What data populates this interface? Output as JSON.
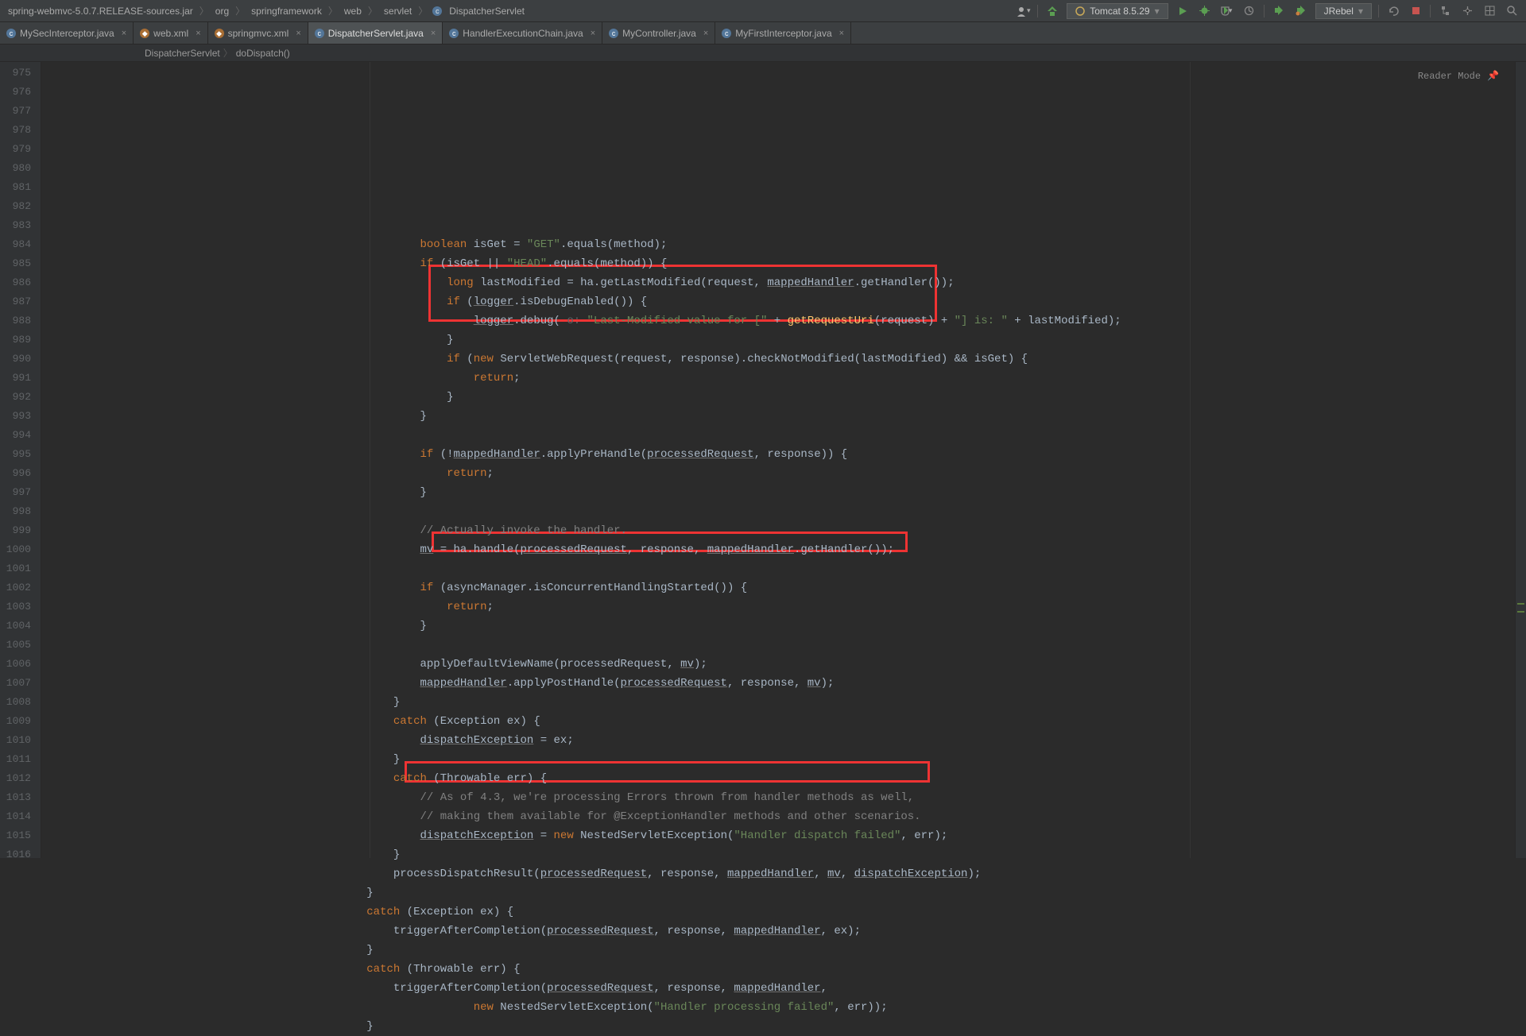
{
  "breadcrumb": {
    "items": [
      "spring-webmvc-5.0.7.RELEASE-sources.jar",
      "org",
      "springframework",
      "web",
      "servlet",
      "DispatcherServlet"
    ]
  },
  "runconfig": {
    "label": "Tomcat 8.5.29"
  },
  "jrebel": {
    "label": "JRebel"
  },
  "tabs": [
    {
      "label": "MySecInterceptor.java",
      "icon": "java",
      "active": false
    },
    {
      "label": "web.xml",
      "icon": "xml",
      "active": false
    },
    {
      "label": "springmvc.xml",
      "icon": "xml",
      "active": false
    },
    {
      "label": "DispatcherServlet.java",
      "icon": "java",
      "active": true
    },
    {
      "label": "HandlerExecutionChain.java",
      "icon": "java",
      "active": false
    },
    {
      "label": "MyController.java",
      "icon": "java",
      "active": false
    },
    {
      "label": "MyFirstInterceptor.java",
      "icon": "java",
      "active": false
    }
  ],
  "navpath": {
    "items": [
      "DispatcherServlet",
      "doDispatch()"
    ]
  },
  "reader_mode": "Reader Mode",
  "lines": {
    "start": 975,
    "end": 1016
  },
  "code": {
    "l975": {
      "indent": 20,
      "tokens": [
        {
          "t": "k",
          "v": "boolean"
        },
        {
          "t": "m",
          "v": " isGet = "
        },
        {
          "t": "s",
          "v": "\"GET\""
        },
        {
          "t": "m",
          "v": ".equals(method);"
        }
      ]
    },
    "l976": {
      "indent": 20,
      "tokens": [
        {
          "t": "k",
          "v": "if"
        },
        {
          "t": "m",
          "v": " (isGet || "
        },
        {
          "t": "s",
          "v": "\"HEAD\""
        },
        {
          "t": "m",
          "v": ".equals(method)) {"
        }
      ]
    },
    "l977": {
      "indent": 24,
      "tokens": [
        {
          "t": "k",
          "v": "long"
        },
        {
          "t": "m",
          "v": " lastModified = ha.getLastModified(request, "
        },
        {
          "t": "vu",
          "v": "mappedHandler"
        },
        {
          "t": "m",
          "v": ".getHandler());"
        }
      ]
    },
    "l978": {
      "indent": 24,
      "tokens": [
        {
          "t": "k",
          "v": "if"
        },
        {
          "t": "m",
          "v": " ("
        },
        {
          "t": "vu",
          "v": "logger"
        },
        {
          "t": "m",
          "v": ".isDebugEnabled()) {"
        }
      ]
    },
    "l979": {
      "indent": 28,
      "tokens": [
        {
          "t": "vu",
          "v": "logger"
        },
        {
          "t": "m",
          "v": ".debug("
        },
        {
          "t": "hint",
          "v": " o: "
        },
        {
          "t": "s",
          "v": "\"Last-Modified value for [\""
        },
        {
          "t": "m",
          "v": " + "
        },
        {
          "t": "fn",
          "v": "getRequestUri"
        },
        {
          "t": "m",
          "v": "(request) + "
        },
        {
          "t": "s",
          "v": "\"] is: \""
        },
        {
          "t": "m",
          "v": " + lastModified);"
        }
      ]
    },
    "l980": {
      "indent": 24,
      "tokens": [
        {
          "t": "m",
          "v": "}"
        }
      ]
    },
    "l981": {
      "indent": 24,
      "tokens": [
        {
          "t": "k",
          "v": "if"
        },
        {
          "t": "m",
          "v": " ("
        },
        {
          "t": "k",
          "v": "new"
        },
        {
          "t": "m",
          "v": " ServletWebRequest(request, response).checkNotModified(lastModified) && isGet) {"
        }
      ]
    },
    "l982": {
      "indent": 28,
      "tokens": [
        {
          "t": "k",
          "v": "return"
        },
        {
          "t": "m",
          "v": ";"
        }
      ]
    },
    "l983": {
      "indent": 24,
      "tokens": [
        {
          "t": "m",
          "v": "}"
        }
      ]
    },
    "l984": {
      "indent": 20,
      "tokens": [
        {
          "t": "m",
          "v": "}"
        }
      ]
    },
    "l985": {
      "indent": 0,
      "tokens": []
    },
    "l986": {
      "indent": 20,
      "tokens": [
        {
          "t": "k",
          "v": "if"
        },
        {
          "t": "m",
          "v": " (!"
        },
        {
          "t": "vu",
          "v": "mappedHandler"
        },
        {
          "t": "m",
          "v": ".applyPreHandle("
        },
        {
          "t": "vu",
          "v": "processedRequest"
        },
        {
          "t": "m",
          "v": ", response)) {"
        }
      ]
    },
    "l987": {
      "indent": 24,
      "tokens": [
        {
          "t": "k",
          "v": "return"
        },
        {
          "t": "m",
          "v": ";"
        }
      ]
    },
    "l988": {
      "indent": 20,
      "tokens": [
        {
          "t": "m",
          "v": "}"
        }
      ]
    },
    "l989": {
      "indent": 0,
      "tokens": []
    },
    "l990": {
      "indent": 20,
      "tokens": [
        {
          "t": "c",
          "v": "// Actually invoke the handler."
        }
      ]
    },
    "l991": {
      "indent": 20,
      "tokens": [
        {
          "t": "vu",
          "v": "mv"
        },
        {
          "t": "m",
          "v": " = ha.handle("
        },
        {
          "t": "vu",
          "v": "processedRequest"
        },
        {
          "t": "m",
          "v": ", response, "
        },
        {
          "t": "vu",
          "v": "mappedHandler"
        },
        {
          "t": "m",
          "v": ".getHandler());"
        }
      ]
    },
    "l992": {
      "indent": 0,
      "tokens": []
    },
    "l993": {
      "indent": 20,
      "tokens": [
        {
          "t": "k",
          "v": "if"
        },
        {
          "t": "m",
          "v": " (asyncManager.isConcurrentHandlingStarted()) {"
        }
      ]
    },
    "l994": {
      "indent": 24,
      "tokens": [
        {
          "t": "k",
          "v": "return"
        },
        {
          "t": "m",
          "v": ";"
        }
      ]
    },
    "l995": {
      "indent": 20,
      "tokens": [
        {
          "t": "m",
          "v": "}"
        }
      ]
    },
    "l996": {
      "indent": 0,
      "tokens": []
    },
    "l997": {
      "indent": 20,
      "tokens": [
        {
          "t": "m",
          "v": "applyDefaultViewName(processedRequest, "
        },
        {
          "t": "vu",
          "v": "mv"
        },
        {
          "t": "m",
          "v": ");"
        }
      ]
    },
    "l998": {
      "indent": 20,
      "tokens": [
        {
          "t": "vu",
          "v": "mappedHandler"
        },
        {
          "t": "m",
          "v": ".applyPostHandle("
        },
        {
          "t": "vu",
          "v": "processedRequest"
        },
        {
          "t": "m",
          "v": ", response, "
        },
        {
          "t": "vu",
          "v": "mv"
        },
        {
          "t": "m",
          "v": ");"
        }
      ]
    },
    "l999": {
      "indent": 16,
      "tokens": [
        {
          "t": "m",
          "v": "}"
        }
      ]
    },
    "l1000": {
      "indent": 16,
      "tokens": [
        {
          "t": "k",
          "v": "catch"
        },
        {
          "t": "m",
          "v": " (Exception ex) {"
        }
      ]
    },
    "l1001": {
      "indent": 20,
      "tokens": [
        {
          "t": "vu",
          "v": "dispatchException"
        },
        {
          "t": "m",
          "v": " = ex;"
        }
      ]
    },
    "l1002": {
      "indent": 16,
      "tokens": [
        {
          "t": "m",
          "v": "}"
        }
      ]
    },
    "l1003": {
      "indent": 16,
      "tokens": [
        {
          "t": "k",
          "v": "catch"
        },
        {
          "t": "m",
          "v": " (Throwable err) {"
        }
      ]
    },
    "l1004": {
      "indent": 20,
      "tokens": [
        {
          "t": "c",
          "v": "// As of 4.3, we're processing Errors thrown from handler methods as well,"
        }
      ]
    },
    "l1005": {
      "indent": 20,
      "tokens": [
        {
          "t": "c",
          "v": "// making them available for @ExceptionHandler methods and other scenarios."
        }
      ]
    },
    "l1006": {
      "indent": 20,
      "tokens": [
        {
          "t": "vu",
          "v": "dispatchException"
        },
        {
          "t": "m",
          "v": " = "
        },
        {
          "t": "k",
          "v": "new"
        },
        {
          "t": "m",
          "v": " NestedServletException("
        },
        {
          "t": "s",
          "v": "\"Handler dispatch failed\""
        },
        {
          "t": "m",
          "v": ", err);"
        }
      ]
    },
    "l1007": {
      "indent": 16,
      "tokens": [
        {
          "t": "m",
          "v": "}"
        }
      ]
    },
    "l1008": {
      "indent": 16,
      "tokens": [
        {
          "t": "m",
          "v": "processDispatchResult("
        },
        {
          "t": "vu",
          "v": "processedRequest"
        },
        {
          "t": "m",
          "v": ", response, "
        },
        {
          "t": "vu",
          "v": "mappedHandler"
        },
        {
          "t": "m",
          "v": ", "
        },
        {
          "t": "vu",
          "v": "mv"
        },
        {
          "t": "m",
          "v": ", "
        },
        {
          "t": "vu",
          "v": "dispatchException"
        },
        {
          "t": "m",
          "v": ");"
        }
      ]
    },
    "l1009": {
      "indent": 12,
      "tokens": [
        {
          "t": "m",
          "v": "}"
        }
      ]
    },
    "l1010": {
      "indent": 12,
      "tokens": [
        {
          "t": "k",
          "v": "catch"
        },
        {
          "t": "m",
          "v": " (Exception ex) {"
        }
      ]
    },
    "l1011": {
      "indent": 16,
      "tokens": [
        {
          "t": "m",
          "v": "triggerAfterCompletion("
        },
        {
          "t": "vu",
          "v": "processedRequest"
        },
        {
          "t": "m",
          "v": ", response, "
        },
        {
          "t": "vu",
          "v": "mappedHandler"
        },
        {
          "t": "m",
          "v": ", ex);"
        }
      ]
    },
    "l1012": {
      "indent": 12,
      "tokens": [
        {
          "t": "m",
          "v": "}"
        }
      ]
    },
    "l1013": {
      "indent": 12,
      "tokens": [
        {
          "t": "k",
          "v": "catch"
        },
        {
          "t": "m",
          "v": " (Throwable err) {"
        }
      ]
    },
    "l1014": {
      "indent": 16,
      "tokens": [
        {
          "t": "m",
          "v": "triggerAfterCompletion("
        },
        {
          "t": "vu",
          "v": "processedRequest"
        },
        {
          "t": "m",
          "v": ", response, "
        },
        {
          "t": "vu",
          "v": "mappedHandler"
        },
        {
          "t": "m",
          "v": ","
        }
      ]
    },
    "l1015": {
      "indent": 28,
      "tokens": [
        {
          "t": "k",
          "v": "new"
        },
        {
          "t": "m",
          "v": " NestedServletException("
        },
        {
          "t": "s",
          "v": "\"Handler processing failed\""
        },
        {
          "t": "m",
          "v": ", err));"
        }
      ]
    },
    "l1016": {
      "indent": 12,
      "tokens": [
        {
          "t": "m",
          "v": "}"
        }
      ]
    }
  }
}
